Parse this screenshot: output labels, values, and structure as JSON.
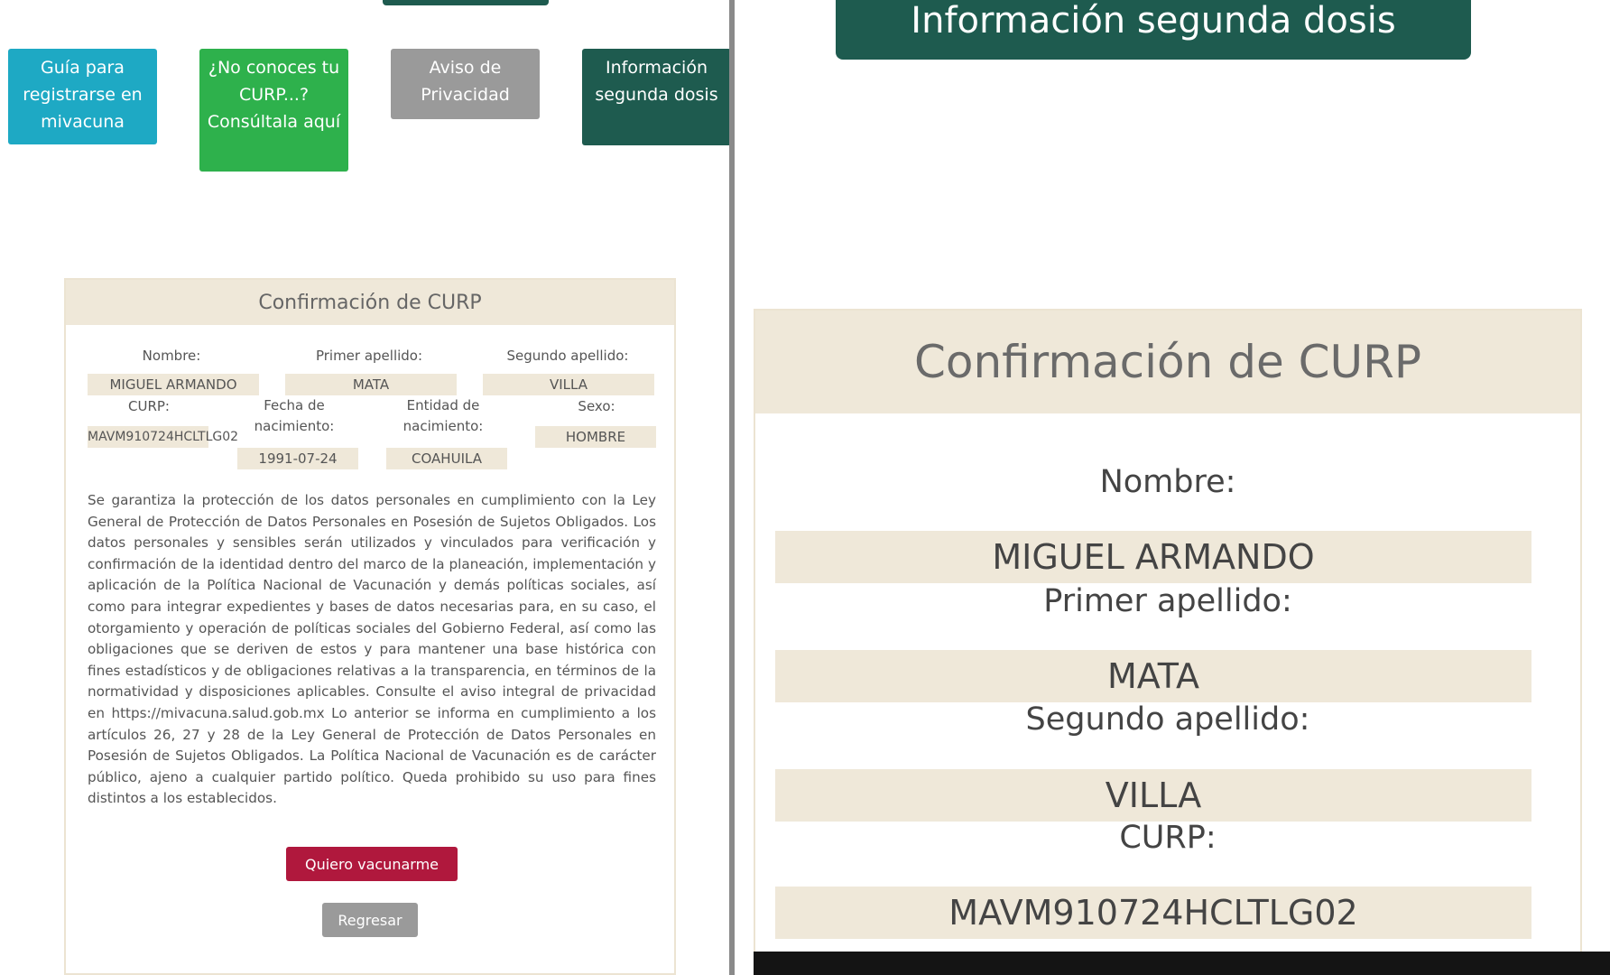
{
  "left": {
    "nav_buttons": [
      {
        "label": "Guía para registrarse en mivacuna",
        "color": "#1ea9c4"
      },
      {
        "label": "¿No conoces tu CURP...? Consúltala aquí",
        "color": "#2eb14c"
      },
      {
        "label": "Aviso de Privacidad",
        "color": "#9a9a9a"
      },
      {
        "label": "Información segunda dosis",
        "color": "#1e5b4f"
      }
    ],
    "card": {
      "title": "Confirmación de CURP",
      "labels": {
        "nombre": "Nombre:",
        "primer_apellido": "Primer apellido:",
        "segundo_apellido": "Segundo apellido:",
        "curp": "CURP:",
        "fecha_nacimiento": "Fecha de nacimiento:",
        "entidad_nacimiento": "Entidad de nacimiento:",
        "sexo": "Sexo:"
      },
      "values": {
        "nombre": "MIGUEL ARMANDO",
        "primer_apellido": "MATA",
        "segundo_apellido": "VILLA",
        "curp": "MAVM910724HCLTLG02",
        "fecha_nacimiento": "1991-07-24",
        "entidad_nacimiento": "COAHUILA",
        "sexo": "HOMBRE"
      },
      "legal_text": "Se garantiza la protección de los datos personales en cumplimiento con la Ley General de Protección de Datos Personales en Posesión de Sujetos Obligados. Los datos personales y sensibles serán utilizados y vinculados para verificación y confirmación de la identidad dentro del marco de la planeación, implementación y aplicación de la Política Nacional de Vacunación y demás políticas sociales, así como para integrar expedientes y bases de datos necesarias para, en su caso, el otorgamiento y operación de políticas sociales del Gobierno Federal, así como las obligaciones que se deriven de estos y para mantener una base histórica con fines estadísticos y de obligaciones relativas a la transparencia, en términos de la normatividad y disposiciones aplicables. Consulte el aviso integral de privacidad en https://mivacuna.salud.gob.mx Lo anterior se informa en cumplimiento a los artículos 26, 27 y 28 de la Ley General de Protección de Datos Personales en Posesión de Sujetos Obligados. La Política Nacional de Vacunación es de carácter público, ajeno a cualquier partido político. Queda prohibido su uso para fines distintos a los establecidos.",
      "primary_button": "Quiero vacunarme",
      "secondary_button": "Regresar"
    }
  },
  "right": {
    "title": "Información segunda dosis",
    "card_title": "Confirmación de CURP",
    "fields": [
      {
        "label": "Nombre:",
        "value": "MIGUEL ARMANDO"
      },
      {
        "label": "Primer apellido:",
        "value": "MATA"
      },
      {
        "label": "Segundo apellido:",
        "value": "VILLA"
      },
      {
        "label": "CURP:",
        "value": "MAVM910724HCLTLG02"
      }
    ]
  },
  "colors": {
    "dark_green": "#1e5b4f",
    "beige": "#efe8d9",
    "crimson": "#b0183d",
    "gray": "#9a9a9a"
  }
}
